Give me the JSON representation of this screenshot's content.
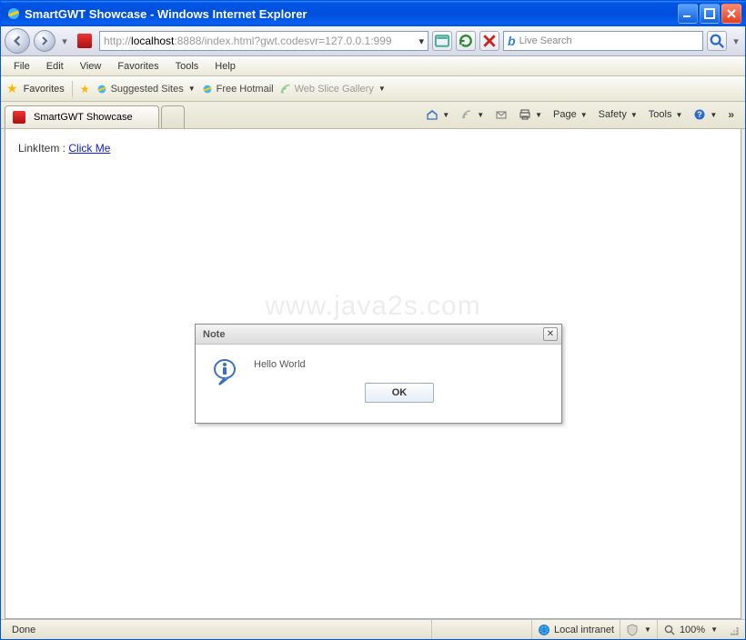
{
  "titlebar": {
    "title": "SmartGWT Showcase - Windows Internet Explorer"
  },
  "nav": {
    "url_pre": "http://",
    "url_host": "localhost",
    "url_rest": ":8888/index.html?gwt.codesvr=127.0.0.1:999",
    "search_placeholder": "Live Search"
  },
  "menu": {
    "file": "File",
    "edit": "Edit",
    "view": "View",
    "favorites": "Favorites",
    "tools": "Tools",
    "help": "Help"
  },
  "favbar": {
    "favorites": "Favorites",
    "suggested": "Suggested Sites",
    "hotmail": "Free Hotmail",
    "webslice": "Web Slice Gallery"
  },
  "tab": {
    "label": "SmartGWT Showcase"
  },
  "cmd": {
    "page": "Page",
    "safety": "Safety",
    "tools": "Tools"
  },
  "content": {
    "label": "LinkItem : ",
    "link": "Click Me"
  },
  "watermark": "www.java2s.com",
  "dialog": {
    "title": "Note",
    "message": "Hello World",
    "ok": "OK"
  },
  "status": {
    "done": "Done",
    "zone": "Local intranet",
    "zoom": "100%"
  }
}
